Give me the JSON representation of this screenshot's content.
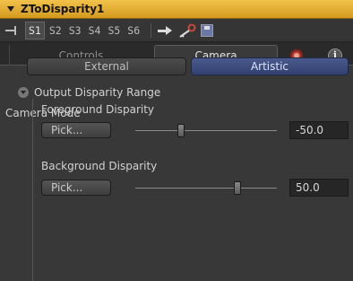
{
  "header": {
    "title": "ZToDisparity1"
  },
  "toolbar": {
    "slots": [
      "S1",
      "S2",
      "S3",
      "S4",
      "S5",
      "S6"
    ],
    "active_slot": "S1"
  },
  "tabs": {
    "controls": "Controls",
    "camera": "Camera",
    "info": "i"
  },
  "camera_mode": {
    "label": "Camera Mode",
    "options": [
      "External",
      "Artistic"
    ],
    "selected": "Artistic"
  },
  "output_range": {
    "label": "Output Disparity Range",
    "foreground": {
      "label": "Foreground Disparity",
      "pick": "Pick...",
      "value": "-50.0",
      "slider_fraction": 0.32
    },
    "background": {
      "label": "Background Disparity",
      "pick": "Pick...",
      "value": "50.0",
      "slider_fraction": 0.72
    }
  },
  "colors": {
    "header": "#e0ac2e",
    "selected_button": "#3f4f82",
    "gear": "#c0392b"
  }
}
